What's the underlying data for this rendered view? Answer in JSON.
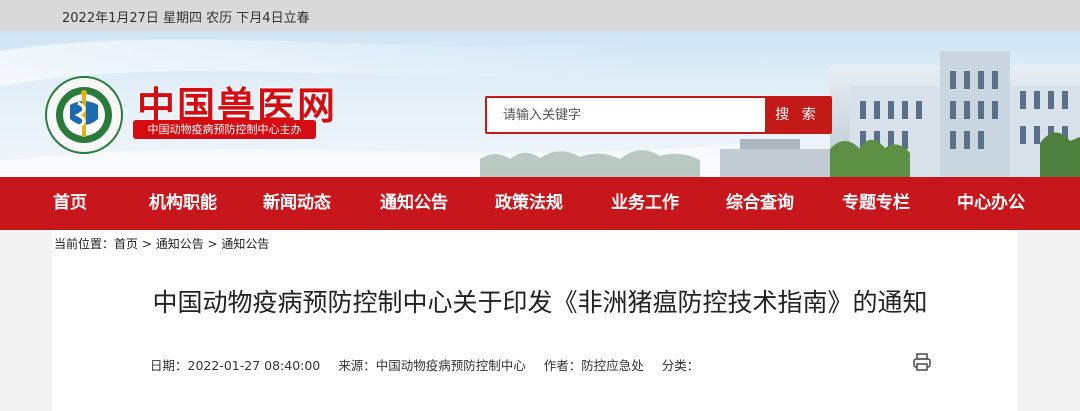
{
  "topbar": {
    "date_text": "2022年1月27日 星期四 农历 下月4日立春"
  },
  "header": {
    "site_title": "中国兽医网",
    "sub_title": "中国动物疫病预防控制中心主办",
    "logo_icon": "caduceus-emblem-icon"
  },
  "search": {
    "placeholder": "请输入关键字",
    "button_label": "搜 索"
  },
  "nav": {
    "items": [
      {
        "label": "首页"
      },
      {
        "label": "机构职能"
      },
      {
        "label": "新闻动态"
      },
      {
        "label": "通知公告"
      },
      {
        "label": "政策法规"
      },
      {
        "label": "业务工作"
      },
      {
        "label": "综合查询"
      },
      {
        "label": "专题专栏"
      },
      {
        "label": "中心办公"
      }
    ]
  },
  "breadcrumb": {
    "prefix": "当前位置：",
    "items": [
      "首页",
      "通知公告",
      "通知公告"
    ],
    "separator": " > "
  },
  "article": {
    "title": "中国动物疫病预防控制中心关于印发《非洲猪瘟防控技术指南》的通知",
    "date": "日期：2022-01-27 08:40:00",
    "source": "来源：中国动物疫病预防控制中心",
    "author": "作者：防控应急处",
    "category": "分类："
  },
  "colors": {
    "brand_red": "#c8161d",
    "title_red": "#d40d12",
    "topbar_gray": "#d9d9d9"
  }
}
